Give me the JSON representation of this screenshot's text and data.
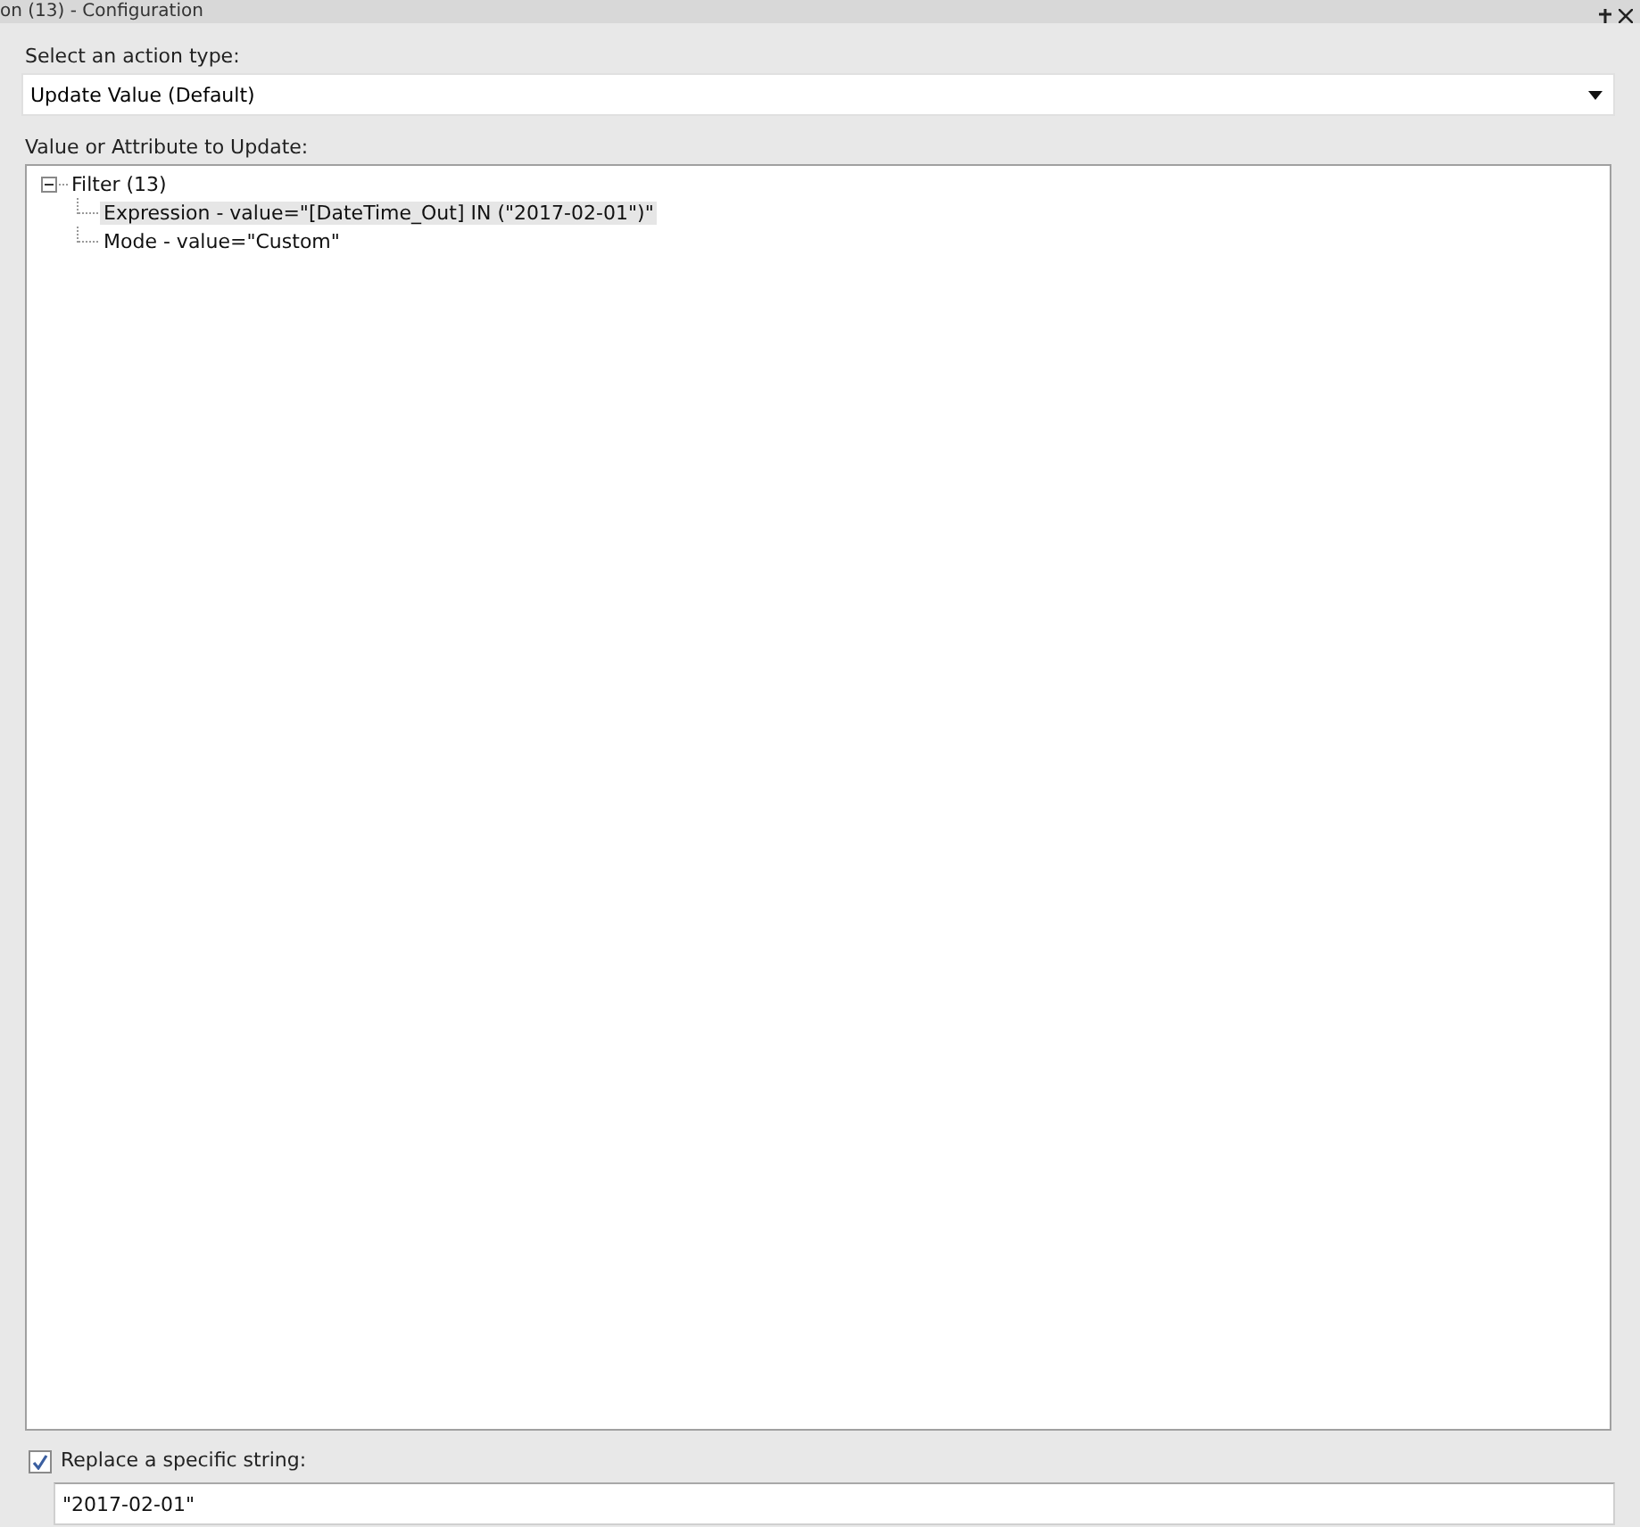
{
  "window": {
    "title": "on (13) - Configuration"
  },
  "action_type": {
    "label": "Select an action type:",
    "value": "Update Value (Default)"
  },
  "tree": {
    "label": "Value or Attribute to Update:",
    "items": [
      {
        "label": "Filter (13)",
        "expanded": true,
        "selected": false,
        "children": [
          {
            "label": "Expression - value=\"[DateTime_Out] IN (\"2017-02-01\")\"",
            "selected": true
          },
          {
            "label": "Mode - value=\"Custom\"",
            "selected": false
          }
        ]
      }
    ]
  },
  "replace": {
    "label": "Replace a specific string:",
    "checked": true,
    "value": "\"2017-02-01\""
  }
}
